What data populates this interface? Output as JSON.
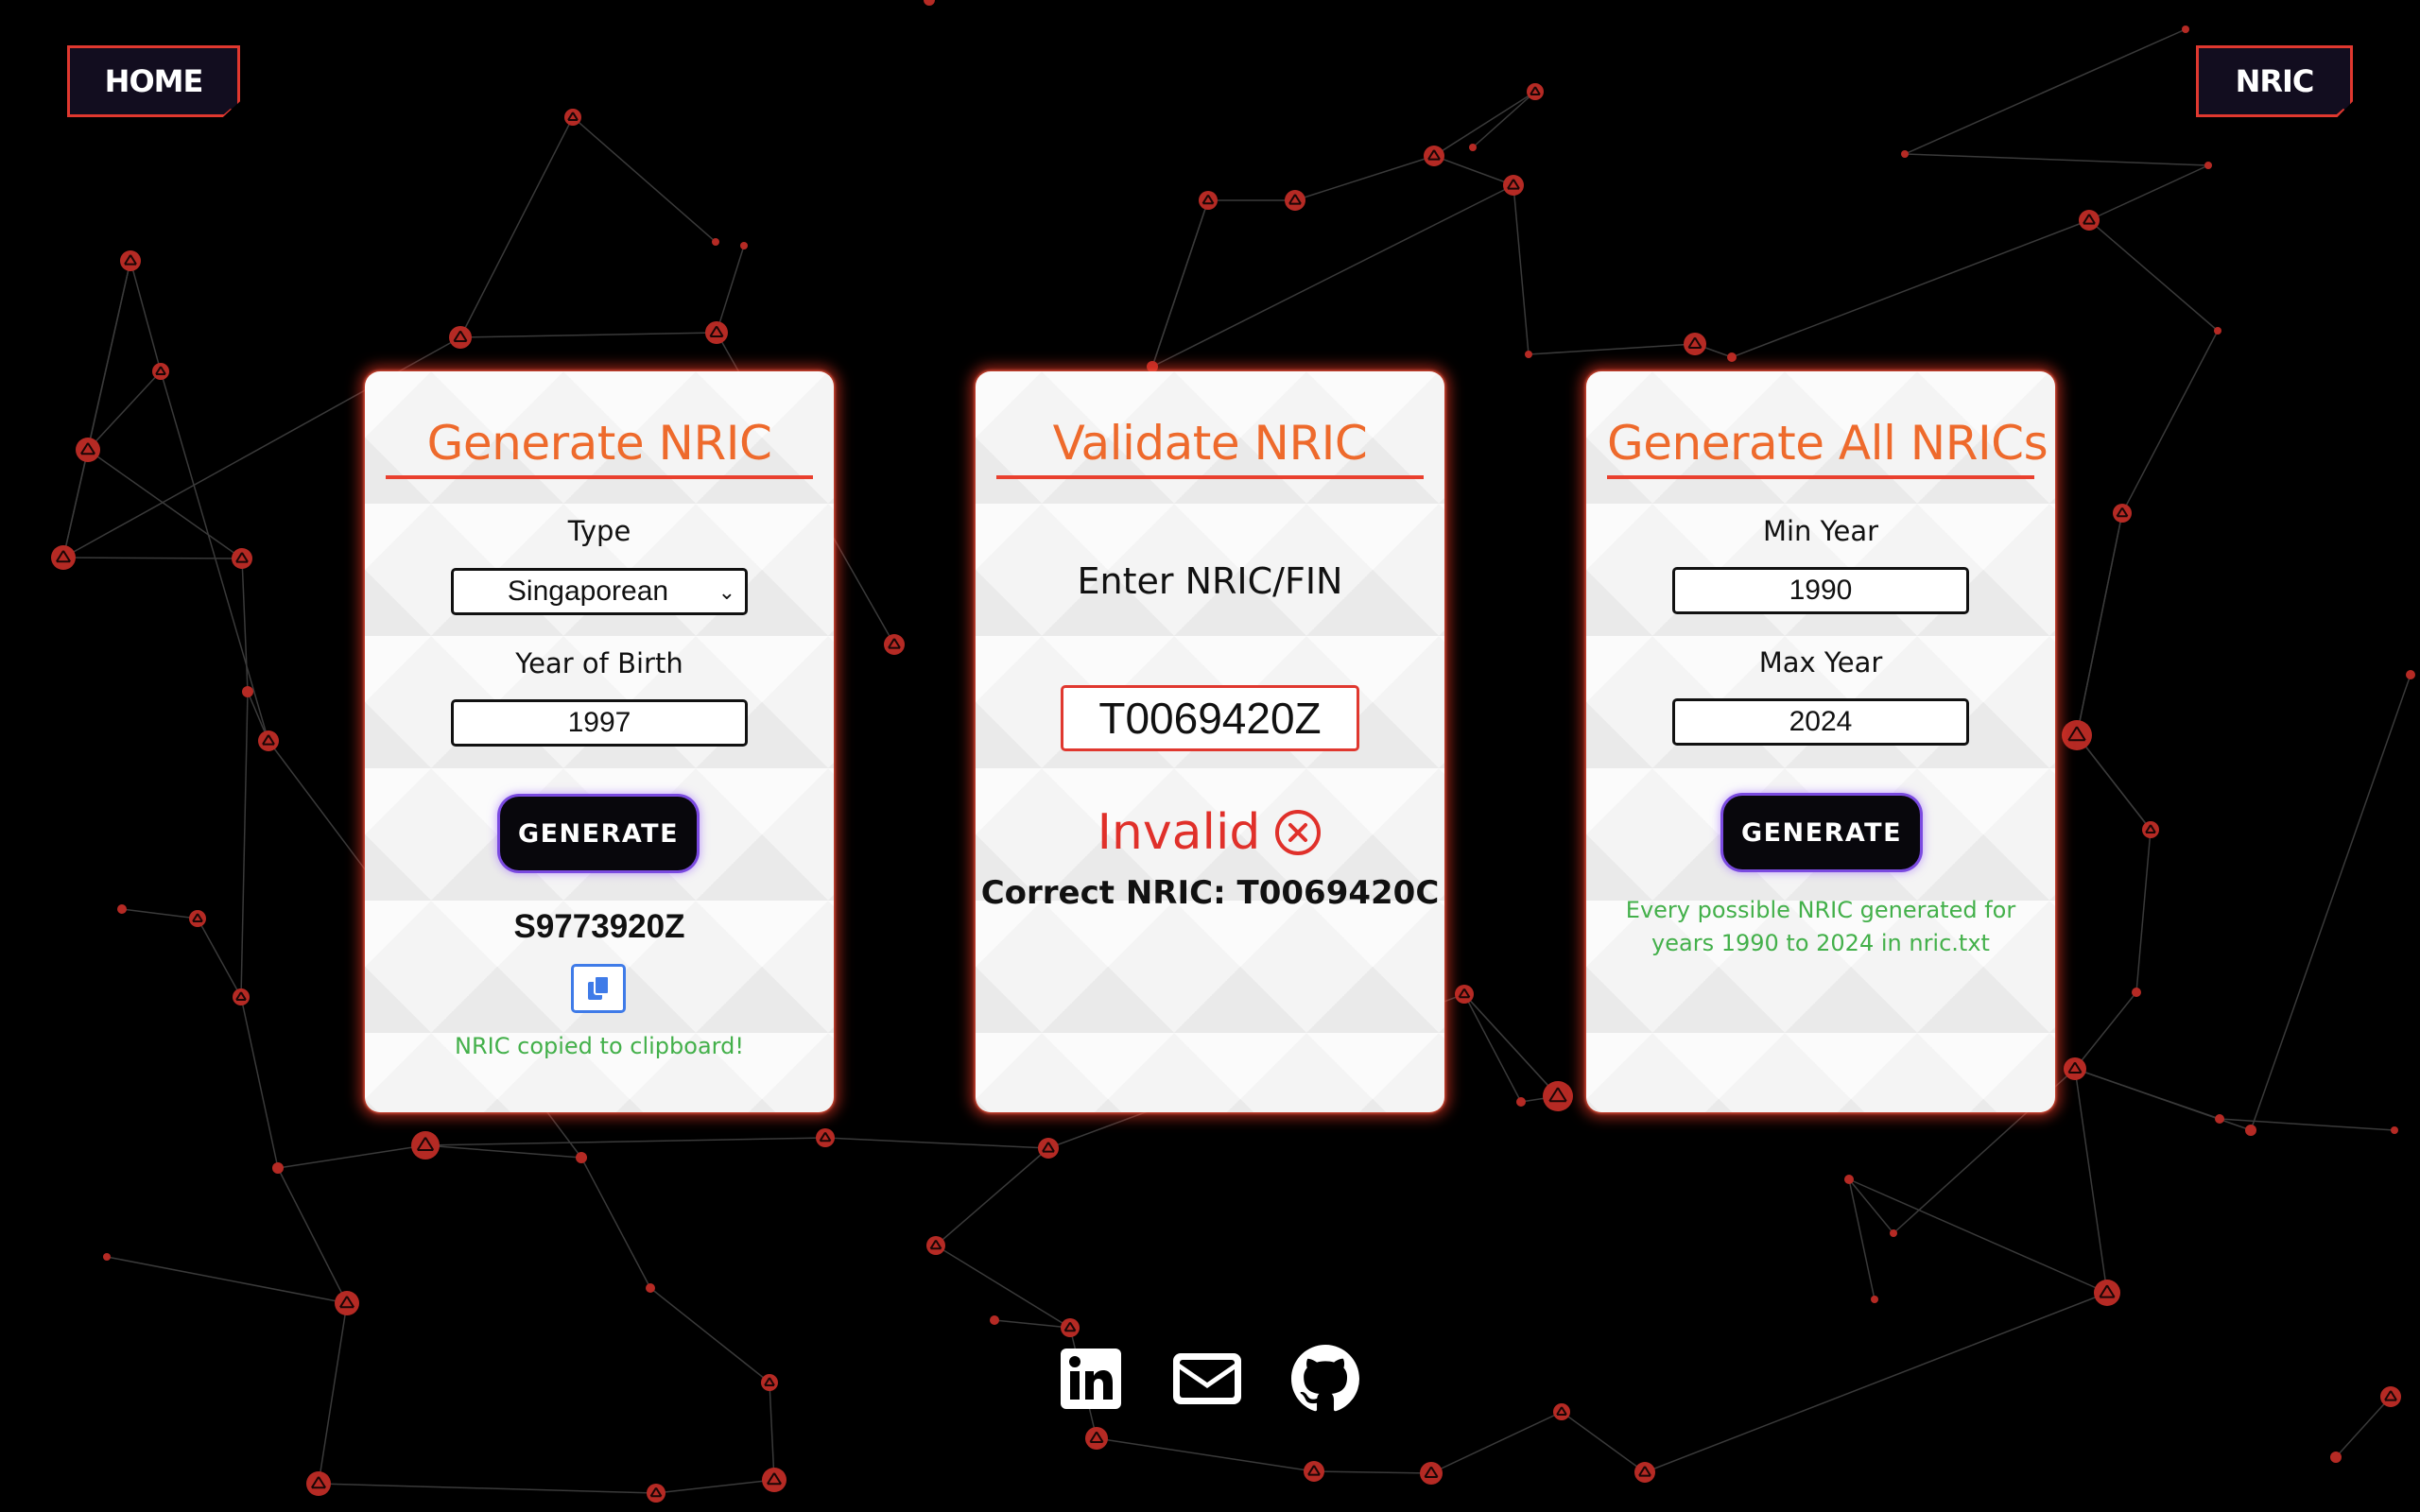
{
  "nav": {
    "home_label": "HOME",
    "nric_label": "NRIC"
  },
  "generate_card": {
    "title": "Generate NRIC",
    "type_label": "Type",
    "type_value": "Singaporean",
    "year_label": "Year of Birth",
    "year_value": "1997",
    "button_label": "GENERATE",
    "result": "S9773920Z",
    "copy_message": "NRIC copied to clipboard!"
  },
  "validate_card": {
    "title": "Validate NRIC",
    "prompt": "Enter NRIC/FIN",
    "input_value": "T0069420Z",
    "status": "Invalid",
    "correct_text": "Correct NRIC: T0069420C"
  },
  "generate_all_card": {
    "title": "Generate All NRICs",
    "min_label": "Min Year",
    "min_value": "1990",
    "max_label": "Max Year",
    "max_value": "2024",
    "button_label": "GENERATE",
    "message_line1": "Every possible NRIC generated for",
    "message_line2": "years 1990 to 2024 in nric.txt"
  },
  "footer": {
    "icons": [
      "linkedin-icon",
      "mail-icon",
      "github-icon"
    ]
  },
  "colors": {
    "background": "#000000",
    "accent_red": "#e0382f",
    "title_orange": "#ee6a2c",
    "success_green": "#43b04a",
    "invalid_red": "#e0302a",
    "copy_blue": "#3f7be8",
    "button_glow": "#7a4ae0"
  }
}
